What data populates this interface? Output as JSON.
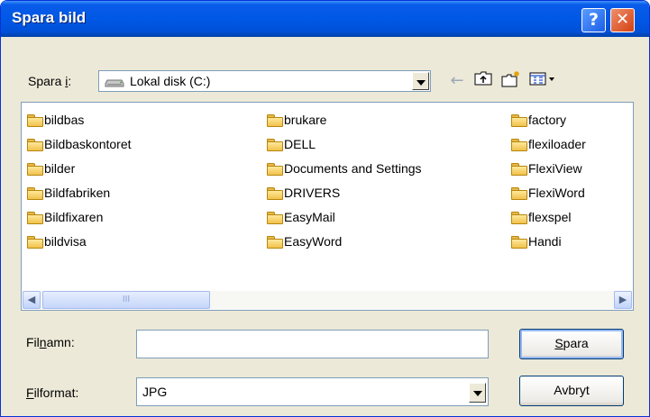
{
  "window": {
    "title": "Spara bild",
    "help_label": "?",
    "close_label": "✕"
  },
  "location": {
    "label_prefix": "Spara ",
    "label_mnemonic": "i",
    "label_suffix": ":",
    "value": "Lokal disk (C:)"
  },
  "toolbar": {
    "back_icon": "back-arrow-icon",
    "up_icon": "up-folder-icon",
    "new_folder_icon": "new-folder-icon",
    "view_icon": "view-menu-icon"
  },
  "files": {
    "columns": [
      [
        "bildbas",
        "Bildbaskontoret",
        "bilder",
        "Bildfabriken",
        "Bildfixaren",
        "bildvisa"
      ],
      [
        "brukare",
        "DELL",
        "Documents and Settings",
        "DRIVERS",
        "EasyMail",
        "EasyWord"
      ],
      [
        "factory",
        "flexiloader",
        "FlexiView",
        "FlexiWord",
        "flexspel",
        "Handi"
      ]
    ],
    "scrollbar_thumb": "III"
  },
  "filename": {
    "label_a": "Fil",
    "label_m": "n",
    "label_b": "amn:",
    "value": ""
  },
  "format": {
    "label_m": "F",
    "label_b": "ilformat:",
    "value": "JPG"
  },
  "buttons": {
    "save_m": "S",
    "save_rest": "para",
    "cancel": "Avbryt"
  }
}
